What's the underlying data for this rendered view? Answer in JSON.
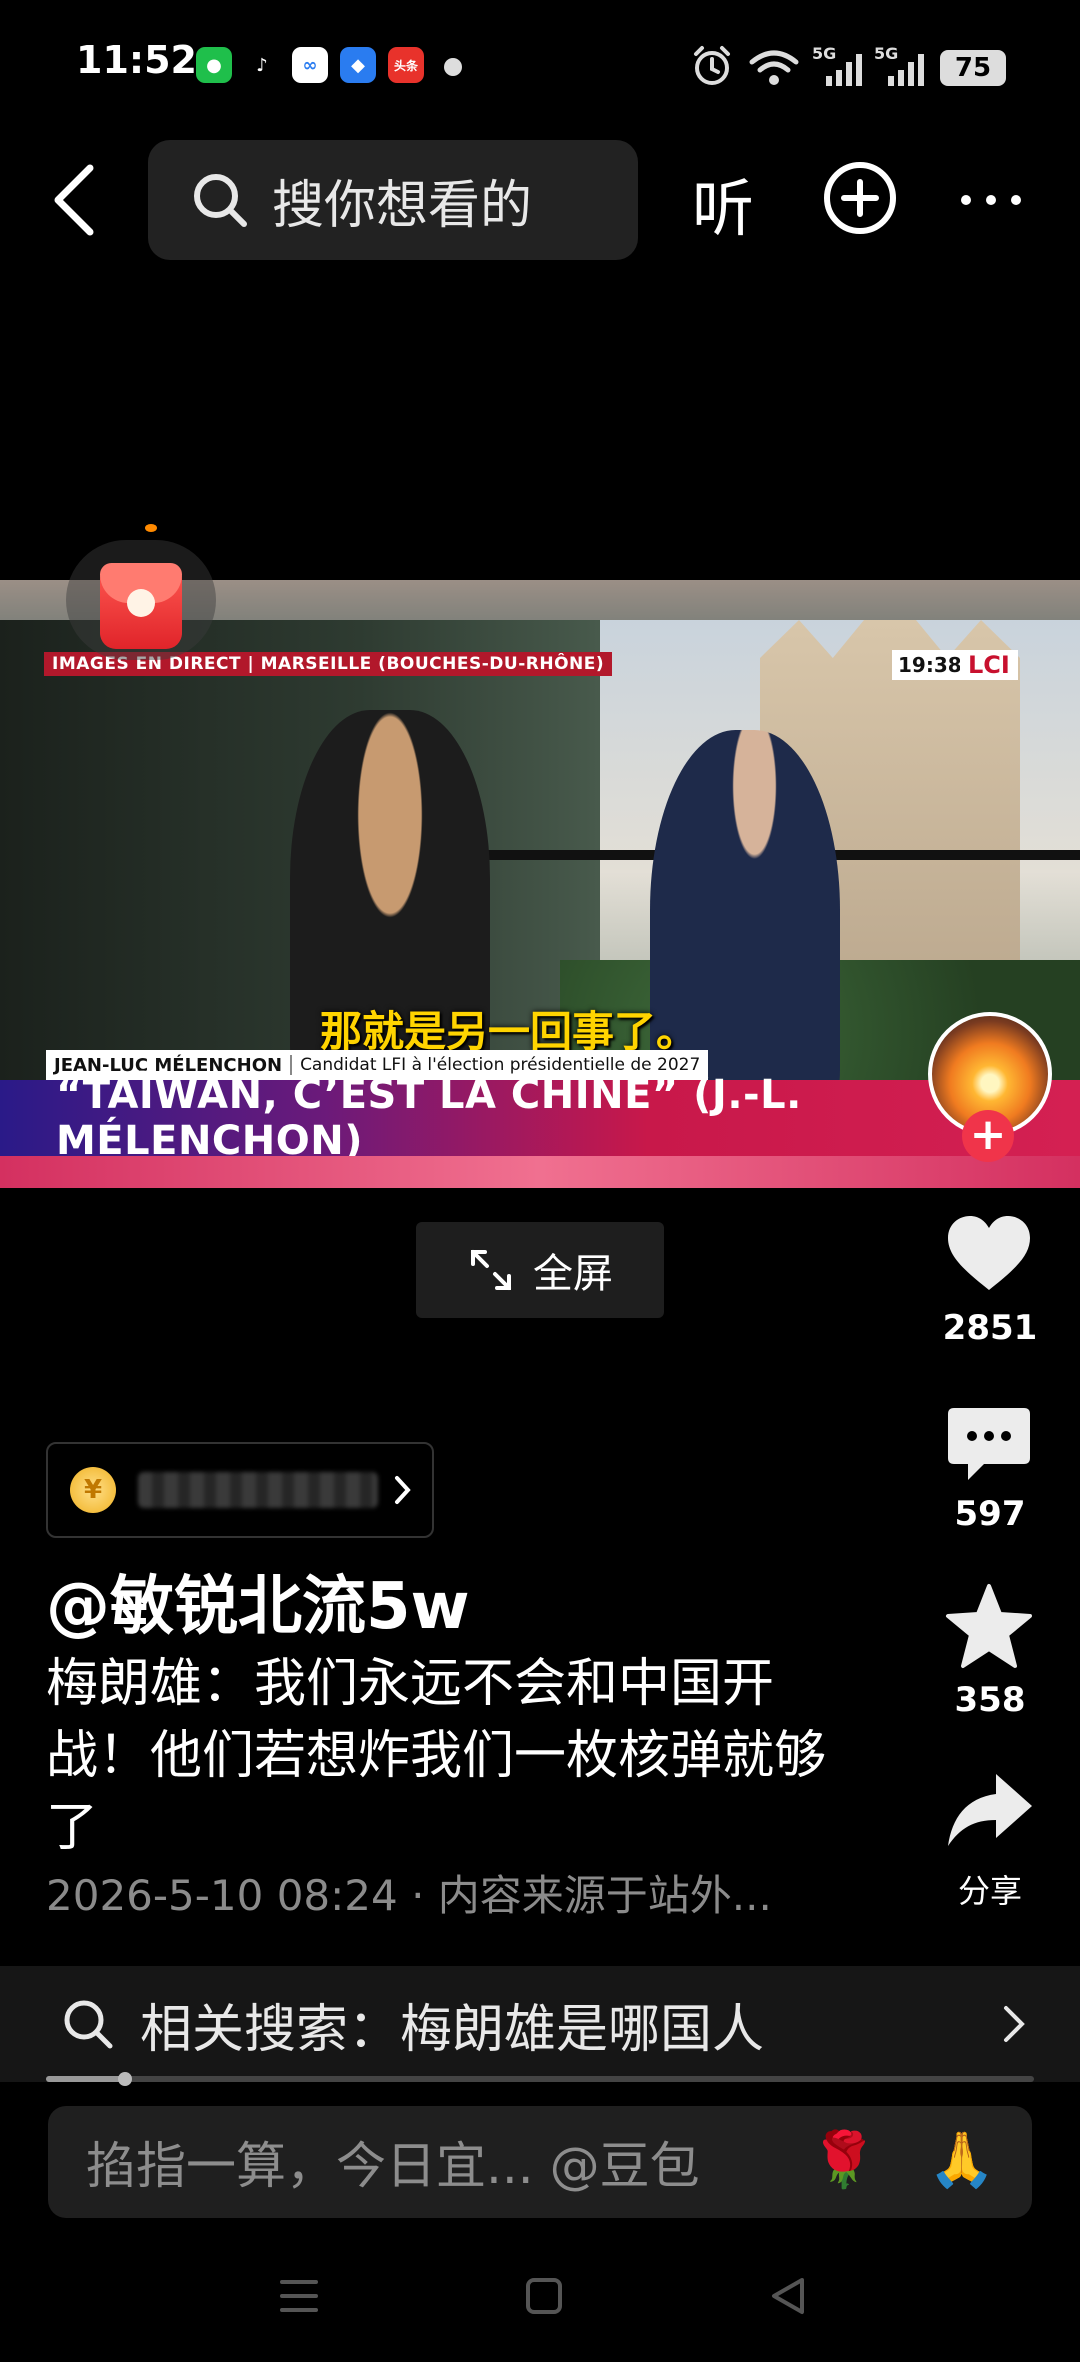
{
  "status_bar": {
    "time": "11:52",
    "apps": [
      {
        "icon": "wechat-icon",
        "color": "#1fbf4b",
        "glyph": "●"
      },
      {
        "icon": "tiktok-icon",
        "color": "#000000",
        "glyph": "♪"
      },
      {
        "icon": "cloud-app-icon",
        "color": "#ffffff",
        "glyph": "∞"
      },
      {
        "icon": "browser-app-icon",
        "color": "#2a7cf0",
        "glyph": "◆"
      },
      {
        "icon": "toutiao-icon",
        "color": "#e8322b",
        "glyph": "头条"
      }
    ],
    "signal_1": "5G",
    "signal_2": "5G",
    "battery": "75"
  },
  "top_bar": {
    "search_placeholder": "搜你想看的",
    "listen_label": "听"
  },
  "video": {
    "live_tag": "IMAGES EN DIRECT | MARSEILLE (BOUCHES-DU-RHÔNE)",
    "clock": "19:38",
    "channel": "LCI",
    "subtitle": "那就是另一回事了。",
    "speaker_name": "JEAN-LUC MÉLENCHON",
    "speaker_role": "Candidat LFI à l'élection présidentielle de 2027",
    "banner": "“TAÏWAN, C’EST LA CHINE” (J.-L. MÉLENCHON)"
  },
  "fullscreen_label": "全屏",
  "actions": {
    "likes": "2851",
    "comments": "597",
    "favorites": "358",
    "share_label": "分享"
  },
  "post": {
    "coin_symbol": "¥",
    "author": "@敏锐北流5w",
    "description": "梅朗雄：我们永远不会和中国开战！他们若想炸我们一枚核弹就够了",
    "meta": "2026-5-10 08:24 · 内容来源于站外..."
  },
  "related_search": {
    "text": "相关搜索：梅朗雄是哪国人",
    "progress": 0.08
  },
  "comment_input": {
    "text": "掐指一算，今日宜... @豆包",
    "emoji_1": "🌹",
    "emoji_2": "🙏"
  }
}
